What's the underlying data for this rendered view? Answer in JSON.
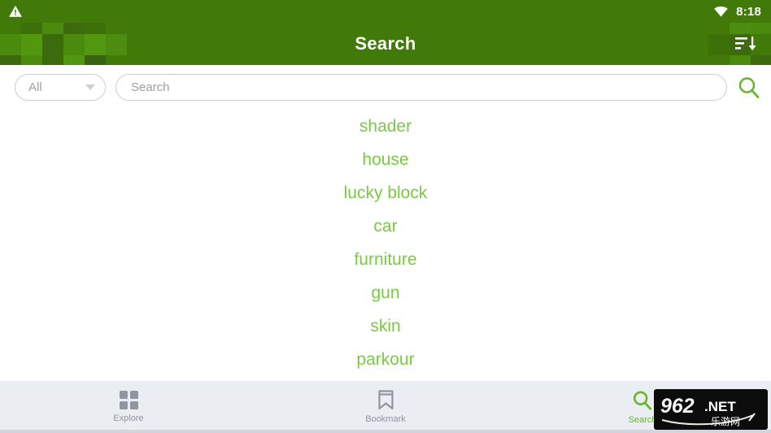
{
  "status_bar": {
    "warning_icon": "warning-triangle-icon",
    "wifi_icon": "wifi-icon",
    "time": "8:18"
  },
  "header": {
    "title": "Search",
    "sort_icon": "sort-descending-icon",
    "background_color": "#417a09",
    "pattern_colors": [
      "#417a09",
      "#3b6b0d",
      "#4a8a0d",
      "#3d7008",
      "#4c8c10",
      "#52980f",
      "#3a6510",
      "#447f0a"
    ]
  },
  "search": {
    "filter_label": "All",
    "filter_options": [
      "All"
    ],
    "chevron_icon": "chevron-down-icon",
    "input_value": "",
    "placeholder": "Search",
    "submit_icon": "search-icon",
    "submit_icon_color": "#6ab42e"
  },
  "suggestions": {
    "text_color": "#7ac943",
    "items": [
      {
        "label": "shader"
      },
      {
        "label": "house"
      },
      {
        "label": "lucky block"
      },
      {
        "label": "car"
      },
      {
        "label": "furniture"
      },
      {
        "label": "gun"
      },
      {
        "label": "skin"
      },
      {
        "label": "parkour"
      }
    ]
  },
  "bottom_nav": {
    "active_color": "#6ab42e",
    "inactive_color": "#9096a0",
    "items": [
      {
        "label": "Explore",
        "icon": "grid-icon",
        "active": false
      },
      {
        "label": "Bookmark",
        "icon": "bookmark-icon",
        "active": false
      },
      {
        "label": "Search",
        "icon": "search-icon",
        "active": true
      }
    ]
  },
  "watermark": {
    "main_text": "962",
    "suffix_text": ".NET",
    "sub_text": "乐游网"
  }
}
